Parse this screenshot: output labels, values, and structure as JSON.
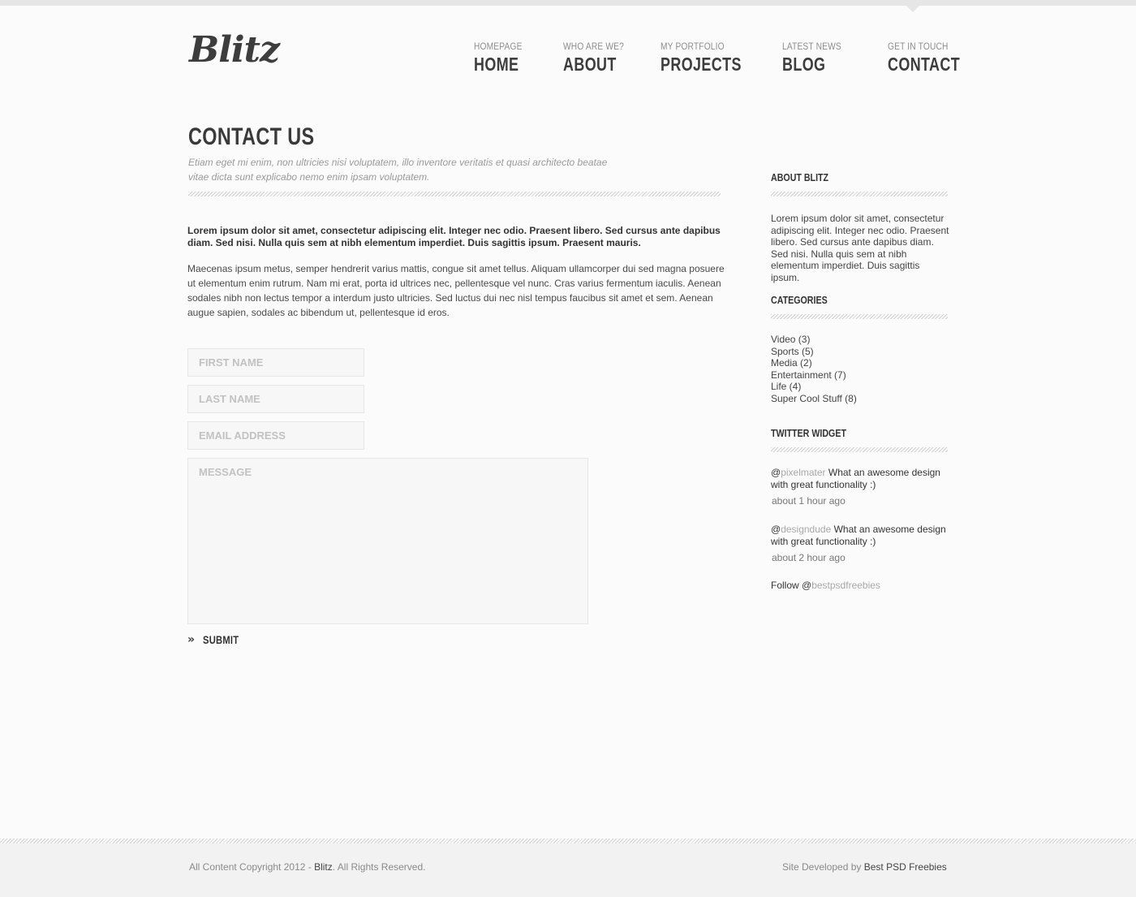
{
  "header": {
    "logo": "Blitz",
    "nav": [
      {
        "sub": "Homepage",
        "main": "Home"
      },
      {
        "sub": "Who are we?",
        "main": "About"
      },
      {
        "sub": "My portfolio",
        "main": "Projects"
      },
      {
        "sub": "Latest news",
        "main": "Blog"
      },
      {
        "sub": "Get in touch",
        "main": "Contact"
      }
    ]
  },
  "main": {
    "title": "Contact Us",
    "subtitle": "Etiam eget mi enim, non ultricies nisi voluptatem, illo inventore veritatis et quasi architecto beatae vitae dicta sunt explicabo nemo enim ipsam voluptatem.",
    "lead": "Lorem ipsum dolor sit amet, consectetur adipiscing elit. Integer nec odio. Praesent libero. Sed cursus ante dapibus diam. Sed nisi. Nulla quis sem at nibh elementum imperdiet. Duis sagittis ipsum. Praesent mauris.",
    "paragraph": "Maecenas ipsum metus, semper hendrerit varius mattis, congue sit amet tellus. Aliquam ullamcorper dui sed magna posuere ut elementum enim rutrum. Nam mi erat, porta id ultrices nec, pellentesque vel nunc. Cras varius fermentum iaculis. Aenean sodales nibh non lectus tempor a interdum justo ultricies. Sed luctus dui nec nisl tempus faucibus sit amet et sem. Aenean augue sapien, sodales ac bibendum ut, pellentesque id eros.",
    "form": {
      "first_name_placeholder": "First Name",
      "last_name_placeholder": "Last Name",
      "email_placeholder": "Email Address",
      "message_placeholder": "Message",
      "submit_label": "Submit"
    }
  },
  "sidebar": {
    "about": {
      "heading": "About Blitz",
      "text": "Lorem ipsum dolor sit amet, consectetur adipiscing elit. Integer nec odio. Praesent libero. Sed cursus ante dapibus diam. Sed nisi. Nulla quis sem at nibh elementum imperdiet. Duis sagittis ipsum."
    },
    "categories": {
      "heading": "Categories",
      "items": [
        "Video (3)",
        "Sports (5)",
        "Media (2)",
        "Entertainment (7)",
        "Life (4)",
        "Super Cool Stuff (8)"
      ]
    },
    "twitter": {
      "heading": "Twitter Widget",
      "tweets": [
        {
          "at": "@",
          "handle": "pixelmater",
          "text": " What an awesome design with great functionality :)",
          "time": "about 1 hour ago"
        },
        {
          "at": "@",
          "handle": "designdude",
          "text": " What an awesome design with great functionality :)",
          "time": "about 2 hour ago"
        }
      ],
      "follow_prefix": "Follow @",
      "follow_handle": "bestpsdfreebies"
    }
  },
  "footer": {
    "left_prefix": "All Content Copyright 2012 - ",
    "left_brand": "Blitz",
    "left_suffix": ". All Rights Reserved.",
    "right_prefix": "Site Developed by ",
    "right_link": "Best PSD Freebies"
  }
}
